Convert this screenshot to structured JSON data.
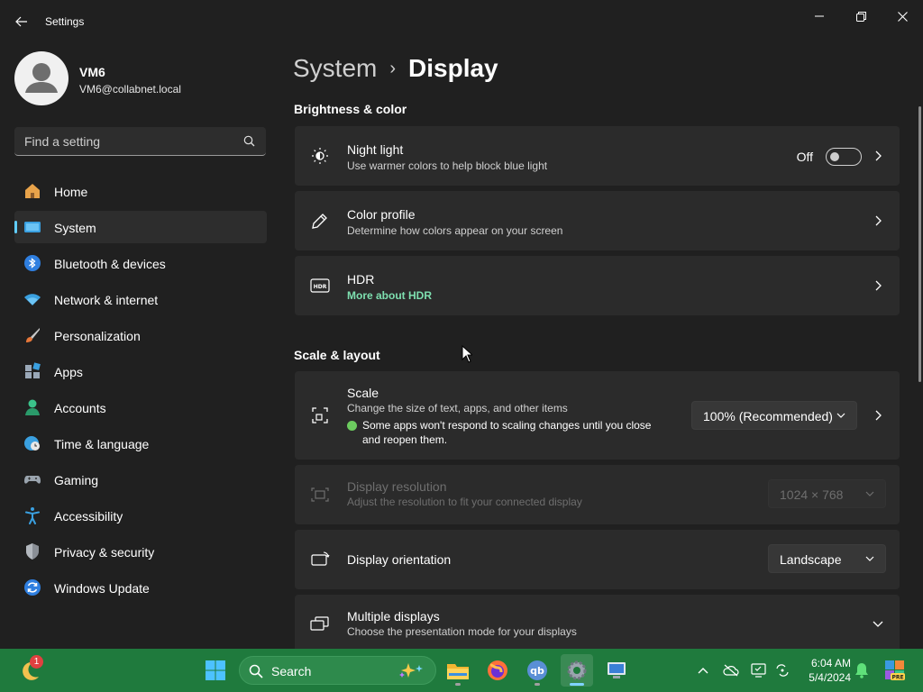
{
  "window": {
    "title": "Settings",
    "controls": [
      "minimize",
      "restore",
      "close"
    ]
  },
  "profile": {
    "name": "VM6",
    "email": "VM6@collabnet.local"
  },
  "search": {
    "placeholder": "Find a setting"
  },
  "sidebar": {
    "items": [
      {
        "label": "Home",
        "icon": "home-icon"
      },
      {
        "label": "System",
        "icon": "system-icon",
        "active": true
      },
      {
        "label": "Bluetooth & devices",
        "icon": "bluetooth-icon"
      },
      {
        "label": "Network & internet",
        "icon": "wifi-icon"
      },
      {
        "label": "Personalization",
        "icon": "brush-icon"
      },
      {
        "label": "Apps",
        "icon": "apps-icon"
      },
      {
        "label": "Accounts",
        "icon": "accounts-icon"
      },
      {
        "label": "Time & language",
        "icon": "globe-clock-icon"
      },
      {
        "label": "Gaming",
        "icon": "gamepad-icon"
      },
      {
        "label": "Accessibility",
        "icon": "accessibility-icon"
      },
      {
        "label": "Privacy & security",
        "icon": "shield-icon"
      },
      {
        "label": "Windows Update",
        "icon": "update-icon"
      }
    ]
  },
  "breadcrumb": {
    "parent": "System",
    "separator": "›",
    "current": "Display"
  },
  "sections": {
    "brightness": "Brightness & color",
    "scale_layout": "Scale & layout"
  },
  "cards": {
    "night_light": {
      "title": "Night light",
      "subtitle": "Use warmer colors to help block blue light",
      "state": "Off"
    },
    "color_profile": {
      "title": "Color profile",
      "subtitle": "Determine how colors appear on your screen"
    },
    "hdr": {
      "title": "HDR",
      "link": "More about HDR"
    },
    "scale": {
      "title": "Scale",
      "subtitle": "Change the size of text, apps, and other items",
      "note": "Some apps won't respond to scaling changes until you close and reopen them.",
      "value": "100% (Recommended)"
    },
    "resolution": {
      "title": "Display resolution",
      "subtitle": "Adjust the resolution to fit your connected display",
      "value": "1024 × 768",
      "disabled": true
    },
    "orientation": {
      "title": "Display orientation",
      "value": "Landscape"
    },
    "multiple": {
      "title": "Multiple displays",
      "subtitle": "Choose the presentation mode for your displays"
    }
  },
  "taskbar": {
    "search_label": "Search",
    "weather_badge": "1",
    "clock_time": "6:04 AM",
    "clock_date": "5/4/2024"
  },
  "colors": {
    "accent": "#60cdff",
    "taskbar": "#1f7a3d",
    "link": "#7ee0b0",
    "background": "#202020",
    "card": "#2b2b2b"
  }
}
